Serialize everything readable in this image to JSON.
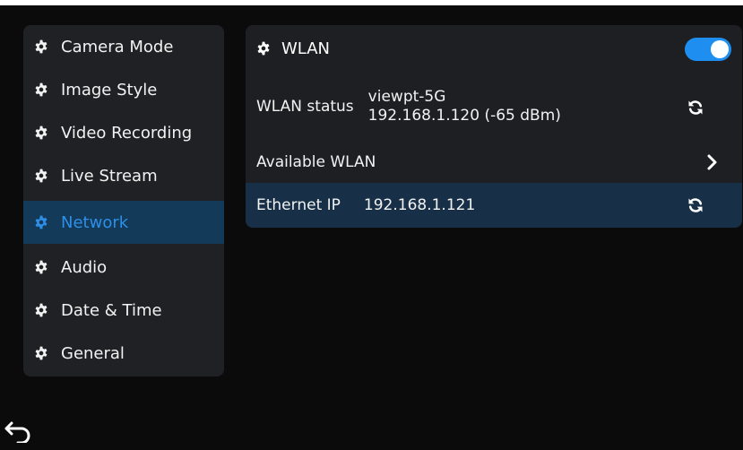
{
  "sidebar": {
    "items": [
      {
        "label": "Camera Mode",
        "icon": "gear-icon"
      },
      {
        "label": "Image Style",
        "icon": "gear-icon"
      },
      {
        "label": "Video Recording",
        "icon": "gear-icon"
      },
      {
        "label": "Live Stream",
        "icon": "gear-icon"
      },
      {
        "label": "Network",
        "icon": "gear-icon",
        "selected": true
      },
      {
        "label": "Audio",
        "icon": "gear-icon"
      },
      {
        "label": "Date & Time",
        "icon": "gear-icon"
      },
      {
        "label": "General",
        "icon": "gear-icon"
      }
    ]
  },
  "network": {
    "wlan": {
      "label": "WLAN",
      "enabled": true
    },
    "status": {
      "label": "WLAN status",
      "ssid": "viewpt-5G",
      "detail": "192.168.1.120 (-65 dBm)",
      "action_icon": "refresh-icon"
    },
    "available": {
      "label": "Available WLAN",
      "action_icon": "chevron-right-icon"
    },
    "ethernet": {
      "label": "Ethernet IP",
      "value": "192.168.1.121",
      "action_icon": "refresh-icon"
    }
  },
  "footer": {
    "back_icon": "back-arrow-icon"
  },
  "colors": {
    "accent": "#1e8ff0",
    "selected_bg": "#143a5a",
    "selected_text": "#2e8fe6",
    "panel_bg": "#1d1f22"
  }
}
